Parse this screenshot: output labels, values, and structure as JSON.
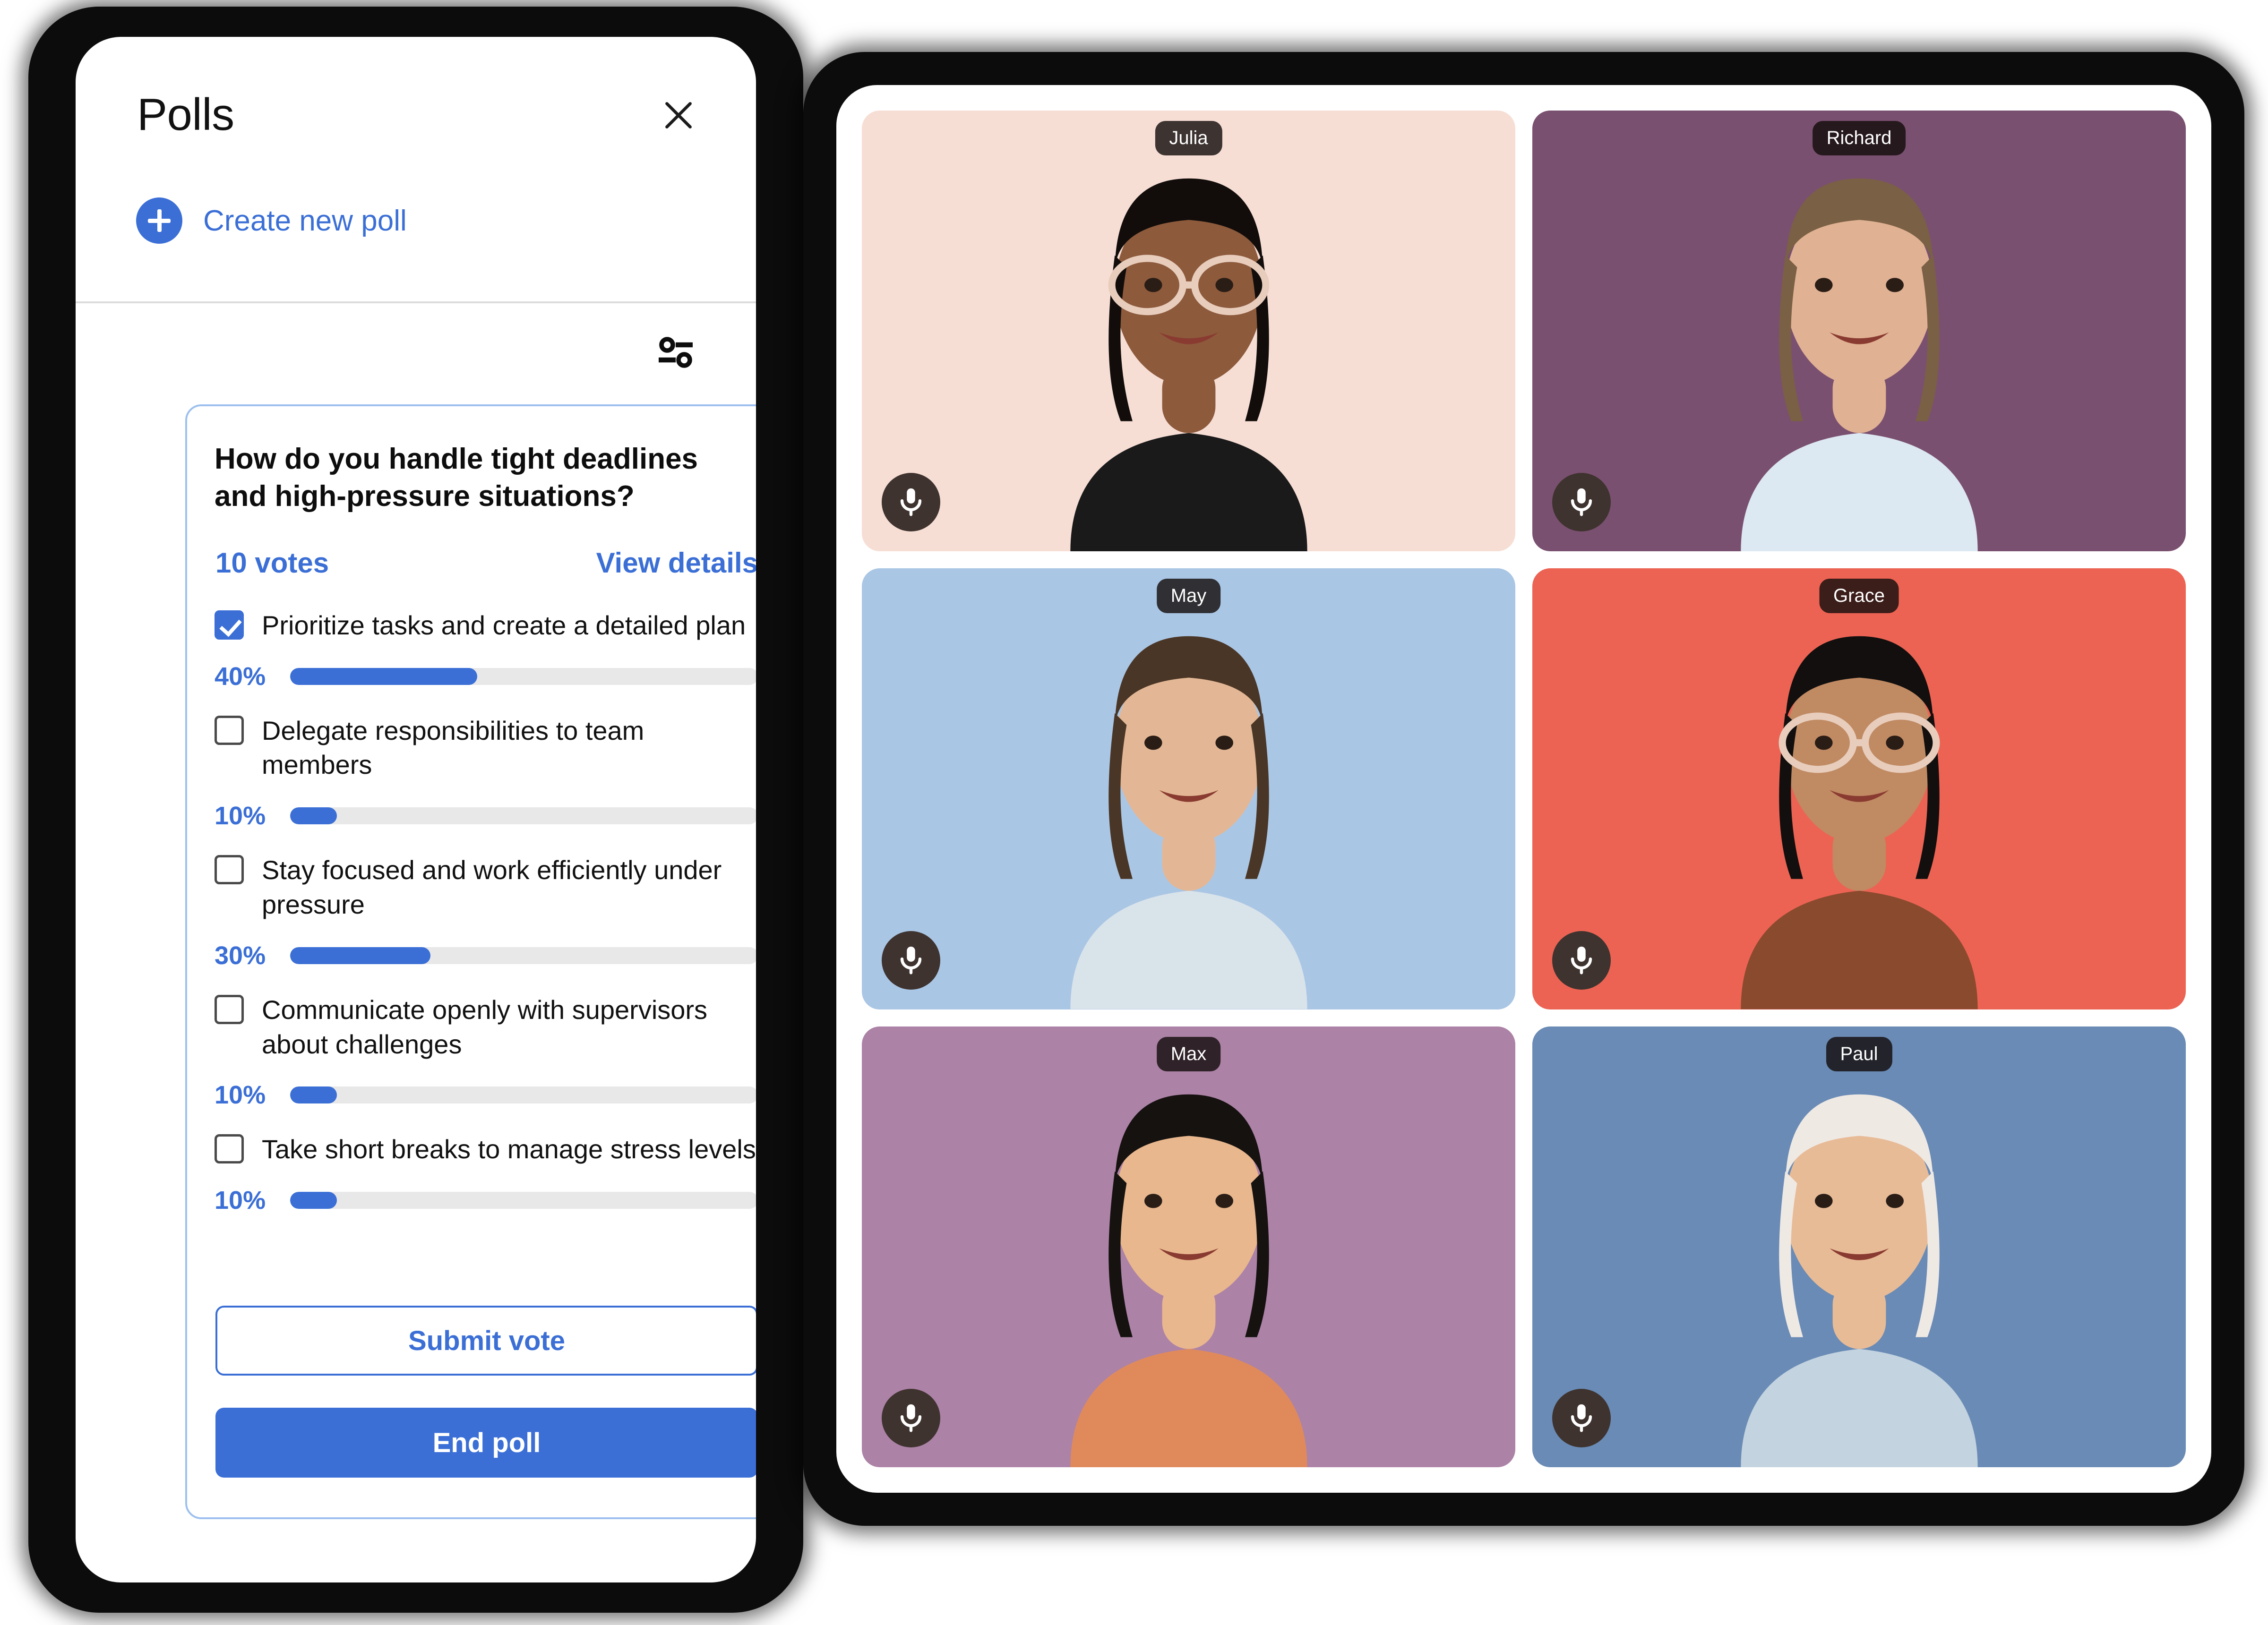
{
  "polls_panel": {
    "title": "Polls",
    "close_icon": "close-icon",
    "create_new_poll": "Create new poll",
    "plus_icon": "plus-icon",
    "filter_icon": "filter-sliders-icon",
    "poll": {
      "question": "How do you handle tight deadlines and high-pressure situations?",
      "votes_label": "10 votes",
      "view_details_label": "View details",
      "options": [
        {
          "label": "Prioritize tasks and create a detailed plan",
          "percent_label": "40%",
          "percent": 40,
          "checked": true
        },
        {
          "label": "Delegate responsibilities to team members",
          "percent_label": "10%",
          "percent": 10,
          "checked": false
        },
        {
          "label": "Stay focused and work efficiently under pressure",
          "percent_label": "30%",
          "percent": 30,
          "checked": false
        },
        {
          "label": "Communicate openly with supervisors about challenges",
          "percent_label": "10%",
          "percent": 10,
          "checked": false
        },
        {
          "label": "Take short breaks to manage stress levels",
          "percent_label": "10%",
          "percent": 10,
          "checked": false
        }
      ],
      "submit_label": "Submit vote",
      "end_label": "End poll"
    },
    "colors": {
      "accent": "#3b6fd6",
      "card_border": "#9dc0ef",
      "track": "#e8e8e8",
      "divider": "#dcdcdc"
    }
  },
  "video_grid": {
    "mic_icon": "microphone-icon",
    "participants": [
      {
        "name": "Julia",
        "bg": "#f7ded5",
        "skin": "#8d5a3c",
        "hair": "#120d0b",
        "shirt": "#1a1a1a",
        "glasses": true
      },
      {
        "name": "Richard",
        "bg": "#7a5070",
        "skin": "#e0b193",
        "hair": "#7a6044",
        "shirt": "#dce8f2",
        "glasses": false
      },
      {
        "name": "May",
        "bg": "#aac6e5",
        "skin": "#e3b795",
        "hair": "#4a3626",
        "shirt": "#d9e3ea",
        "glasses": false
      },
      {
        "name": "Grace",
        "bg": "#ec6353",
        "skin": "#c08a63",
        "hair": "#120f0e",
        "shirt": "#8a4a2e",
        "glasses": true
      },
      {
        "name": "Max",
        "bg": "#ac82a6",
        "skin": "#e8b78e",
        "hair": "#161210",
        "shirt": "#e08a5c",
        "glasses": false
      },
      {
        "name": "Paul",
        "bg": "#6a8bb5",
        "skin": "#e8bb97",
        "hair": "#efe9e4",
        "shirt": "#c3d3e0",
        "glasses": false
      }
    ]
  }
}
